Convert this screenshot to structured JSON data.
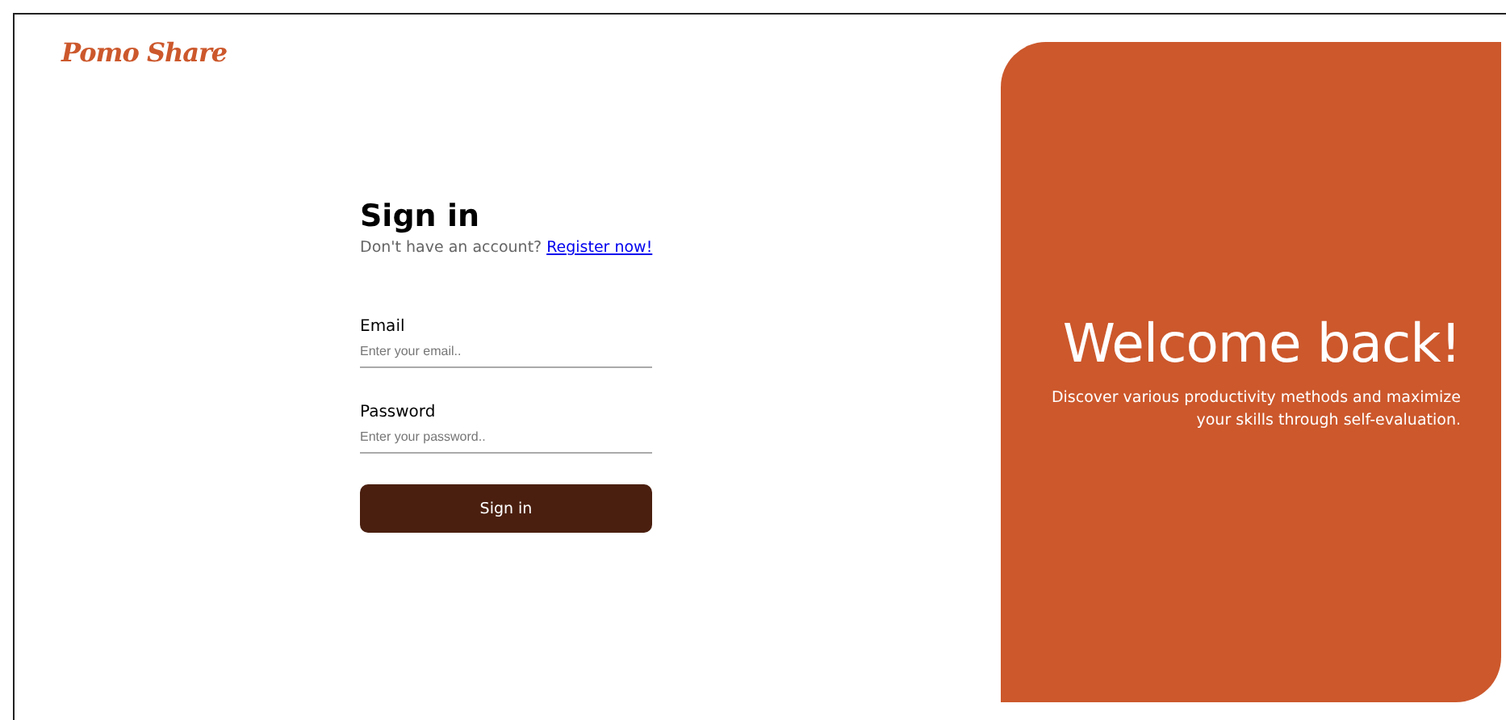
{
  "logo": "Pomo Share",
  "form": {
    "title": "Sign in",
    "prompt": "Don't have an account?",
    "link": "Register now!",
    "fields": [
      {
        "label": "Email",
        "placeholder": "Enter your email.."
      },
      {
        "label": "Password",
        "placeholder": "Enter your password.."
      }
    ],
    "button": "Sign in"
  },
  "panel": {
    "heading": "Welcome back!",
    "text": "Discover various productivity methods and maximize your skills through self-evaluation."
  }
}
